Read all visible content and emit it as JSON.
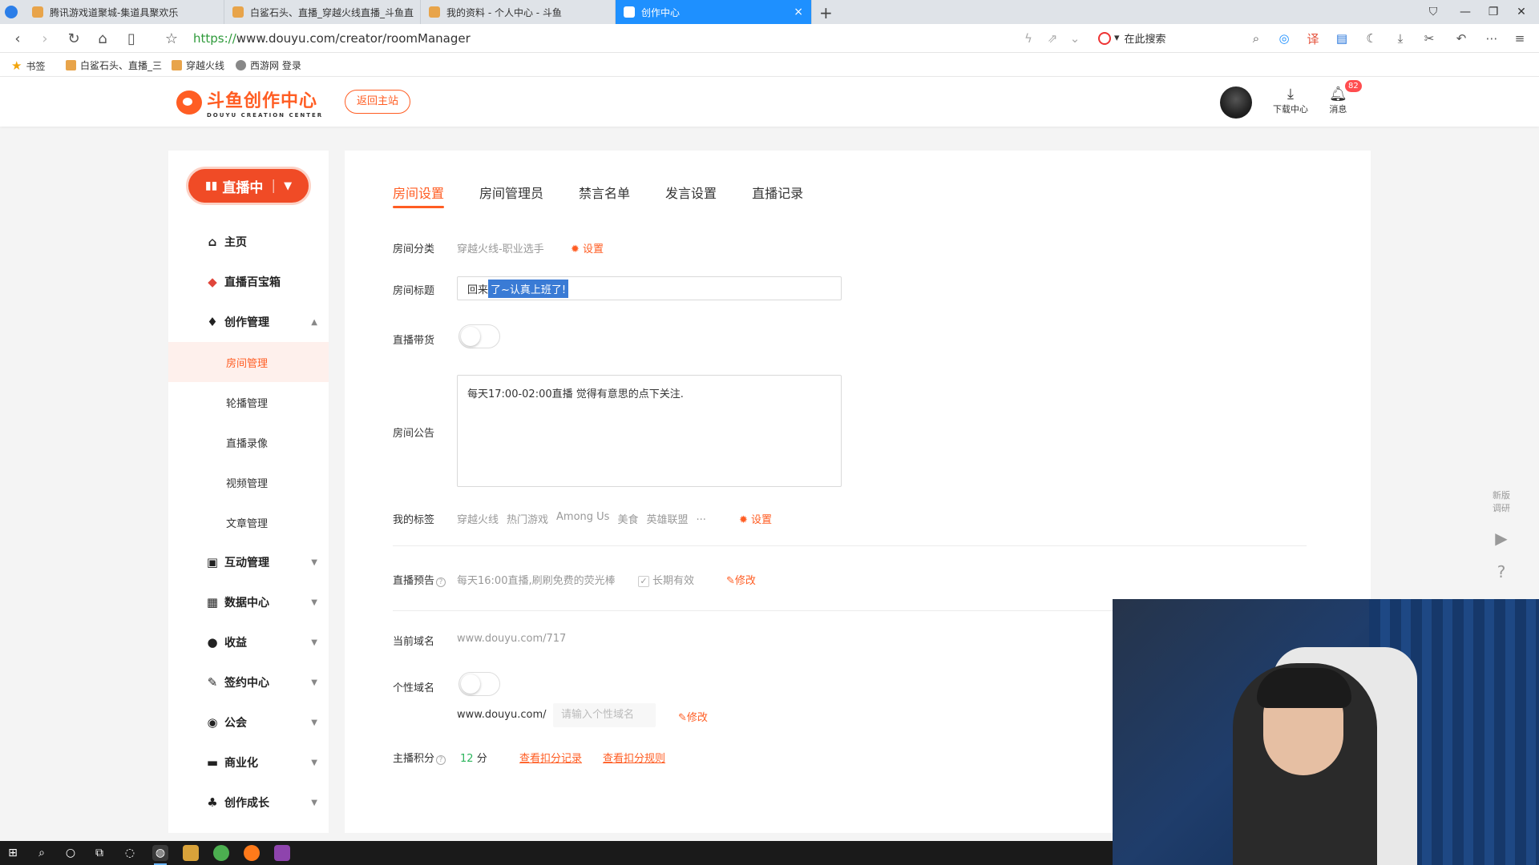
{
  "browser": {
    "tabs": [
      {
        "title": "腾讯游戏道聚城-集道具聚欢乐",
        "active": false
      },
      {
        "title": "白鲨石头、直播_穿越火线直播_斗鱼直",
        "active": false
      },
      {
        "title": "我的资料 - 个人中心 - 斗鱼",
        "active": false
      },
      {
        "title": "创作中心",
        "active": true
      }
    ],
    "new_tab": "+",
    "close_tab": "×",
    "url_proto": "https://",
    "url_rest": "www.douyu.com/creator/roomManager",
    "search_placeholder": "在此搜索",
    "bookmarks": [
      "书签",
      "白鲨石头、直播_三",
      "穿越火线",
      "西游网 登录"
    ]
  },
  "header": {
    "logo_cn": "斗鱼创作中心",
    "logo_en": "DOUYU CREATION CENTER",
    "back_home": "返回主站",
    "download_label": "下载中心",
    "message_label": "消息",
    "message_badge": "82"
  },
  "sidebar": {
    "live_button": "直播中",
    "items": [
      {
        "label": "主页",
        "icon": "home-icon",
        "glyph": "⌂"
      },
      {
        "label": "直播百宝箱",
        "icon": "cube-icon",
        "glyph": "◆"
      },
      {
        "label": "创作管理",
        "icon": "bulb-icon",
        "glyph": "♦",
        "expanded": true
      },
      {
        "label": "互动管理",
        "icon": "chat-icon",
        "glyph": "▣"
      },
      {
        "label": "数据中心",
        "icon": "chart-icon",
        "glyph": "▦"
      },
      {
        "label": "收益",
        "icon": "coin-icon",
        "glyph": "●"
      },
      {
        "label": "签约中心",
        "icon": "pen-icon",
        "glyph": "✎"
      },
      {
        "label": "公会",
        "icon": "guild-icon",
        "glyph": "◉"
      },
      {
        "label": "商业化",
        "icon": "briefcase-icon",
        "glyph": "▬"
      },
      {
        "label": "创作成长",
        "icon": "sprout-icon",
        "glyph": "♣"
      }
    ],
    "sub_items": [
      "房间管理",
      "轮播管理",
      "直播录像",
      "视频管理",
      "文章管理"
    ],
    "active_sub": "房间管理"
  },
  "main": {
    "tabs": [
      "房间设置",
      "房间管理员",
      "禁言名单",
      "发言设置",
      "直播记录"
    ],
    "active_tab": "房间设置",
    "room_category_label": "房间分类",
    "room_category_value": "穿越火线-职业选手",
    "settings_link": "设置",
    "room_title_label": "房间标题",
    "room_title_prefix": "回来",
    "room_title_selected": "了~认真上班了!",
    "live_goods_label": "直播带货",
    "notice_label": "房间公告",
    "notice_text": "每天17:00-02:00直播 觉得有意思的点下关注.",
    "tags_label": "我的标签",
    "tags": [
      "穿越火线",
      "热门游戏",
      "Among Us",
      "美食",
      "英雄联盟",
      "..."
    ],
    "preview_label": "直播预告",
    "preview_text": "每天16:00直播,刷刷免费的荧光棒",
    "long_term": "长期有效",
    "modify": "修改",
    "domain_label": "当前域名",
    "domain_value": "www.douyu.com/717",
    "custom_domain_label": "个性域名",
    "custom_domain_prefix": "www.douyu.com/",
    "custom_domain_placeholder": "请输入个性域名",
    "score_label": "主播积分",
    "score_value": "12",
    "score_unit": "分",
    "deduct_record": "查看扣分记录",
    "deduct_rules": "查看扣分规则"
  },
  "float_bar": {
    "survey": "新版调研"
  },
  "colors": {
    "accent": "#ff5d23",
    "live_red": "#f04b26",
    "tab_active": "#1e90ff"
  }
}
